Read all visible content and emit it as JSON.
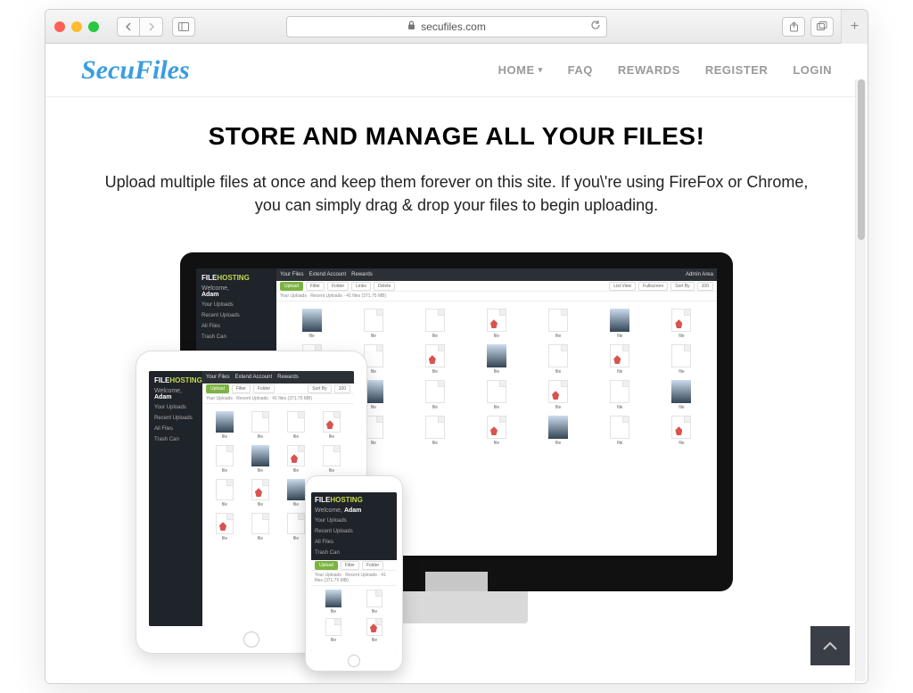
{
  "browser": {
    "address": "secufiles.com"
  },
  "site": {
    "logo": "SecuFiles",
    "nav": {
      "home": "HOME",
      "faq": "FAQ",
      "rewards": "REWARDS",
      "register": "REGISTER",
      "login": "LOGIN"
    }
  },
  "hero": {
    "title": "STORE AND MANAGE ALL YOUR FILES!",
    "subtitle": "Upload multiple files at once and keep them forever on this site. If you\\'re using FireFox or Chrome, you can simply drag & drop your files to begin uploading."
  },
  "mock": {
    "brand_a": "FILE",
    "brand_b": "HOSTING",
    "welcome": "Welcome,",
    "user": "Adam",
    "side_items": [
      "Your Uploads",
      "Recent Uploads",
      "All Files",
      "Trash Can"
    ],
    "topbar": [
      "Your Files",
      "Extend Account",
      "Rewards",
      "Admin Area"
    ],
    "toolbar": {
      "upload": "Upload",
      "filter": "Filter",
      "folder": "Folder",
      "links": "Links",
      "delete": "Delete",
      "listview": "List View",
      "fullscreen": "Fullscreen",
      "sortby": "Sort By",
      "per": "100"
    },
    "crumb": "Your Uploads · Recent Uploads · 41 files (371.75 MB)"
  }
}
